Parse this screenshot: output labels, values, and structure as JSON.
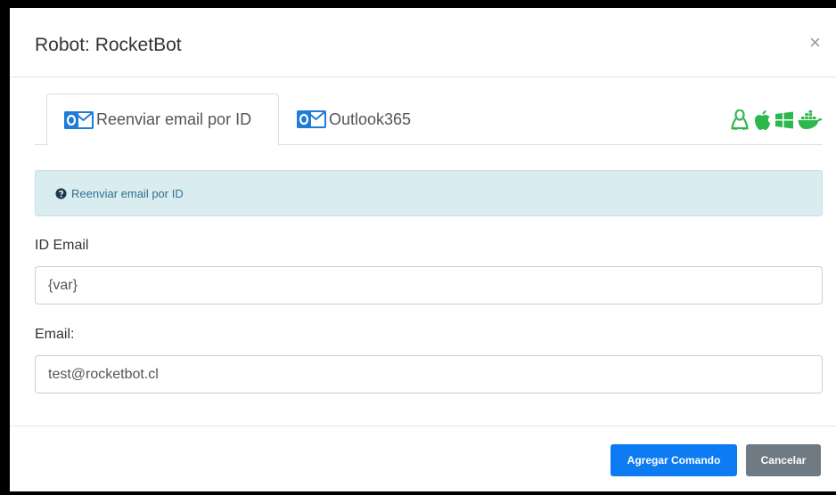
{
  "modal": {
    "title": "Robot: RocketBot",
    "close_symbol": "×"
  },
  "tabs": [
    {
      "label": "Reenviar email por ID",
      "icon": "outlook-icon",
      "active": true
    },
    {
      "label": "Outlook365",
      "icon": "outlook-icon",
      "active": false
    }
  ],
  "os_icons": [
    "linux-icon",
    "apple-icon",
    "windows-icon",
    "docker-icon"
  ],
  "colors": {
    "os_icon_green": "#2eb84b",
    "primary_button": "#0d7bf2",
    "secondary_button": "#6f7a82",
    "alert_bg": "#d9edf0",
    "alert_text": "#31708f"
  },
  "alert": {
    "icon": "question-circle-icon",
    "text": "Reenviar email por ID"
  },
  "fields": {
    "id_email": {
      "label": "ID Email",
      "value": "{var}"
    },
    "email": {
      "label": "Email:",
      "value": "test@rocketbot.cl"
    }
  },
  "footer": {
    "add_label": "Agregar Comando",
    "cancel_label": "Cancelar"
  }
}
